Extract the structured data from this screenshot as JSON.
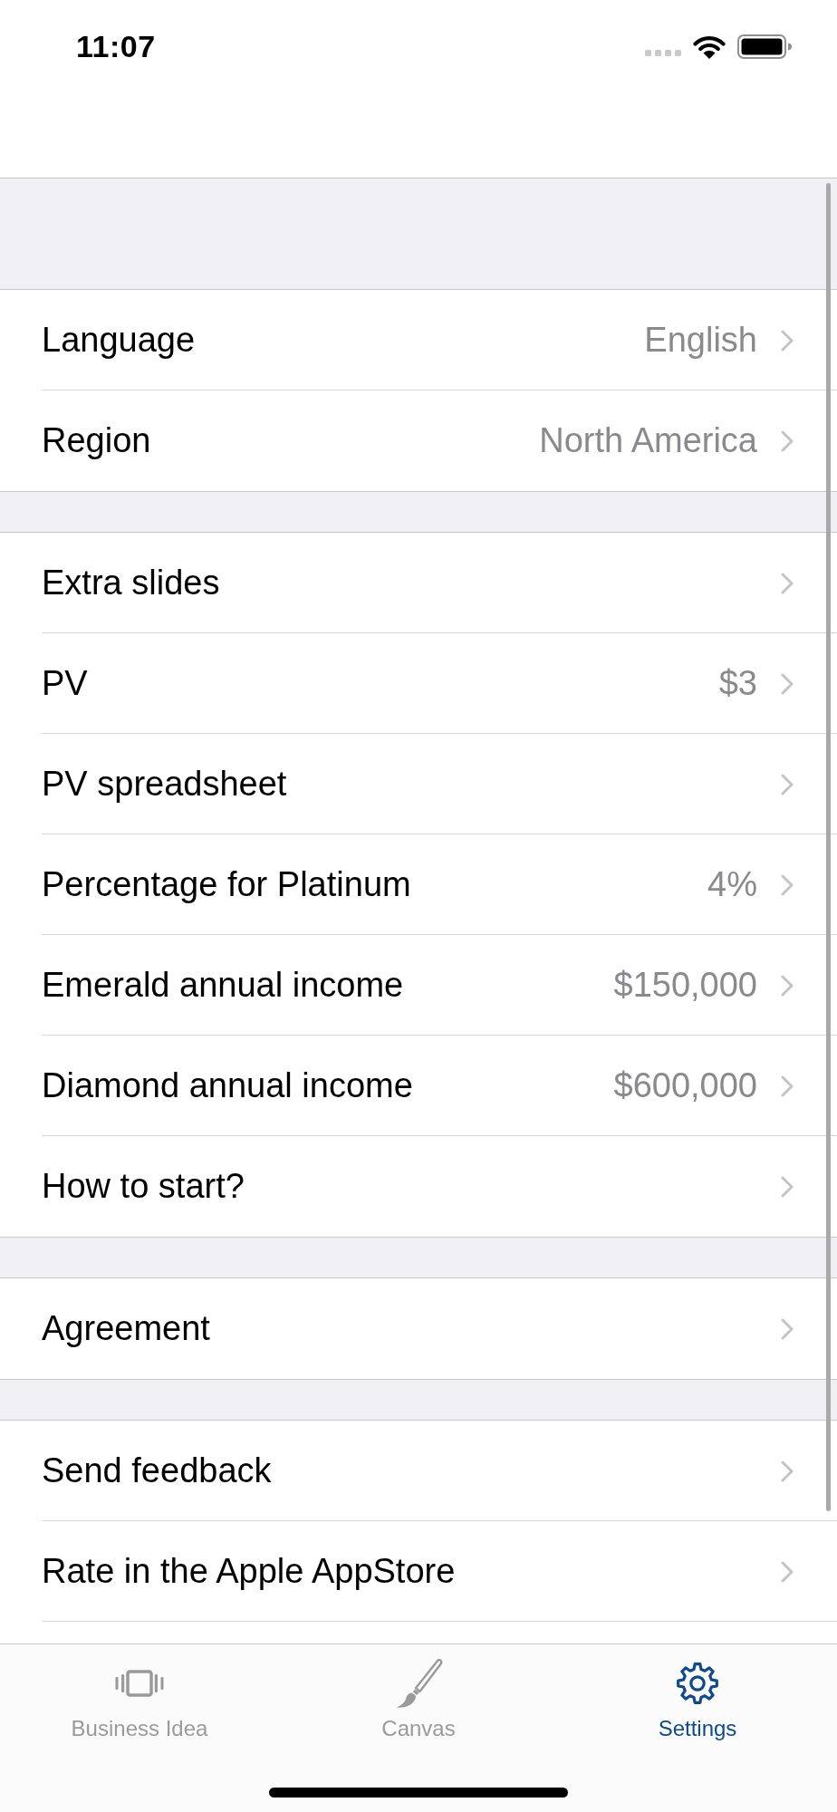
{
  "status_bar": {
    "time": "11:07"
  },
  "sections": [
    {
      "rows": [
        {
          "label": "Language",
          "value": "English"
        },
        {
          "label": "Region",
          "value": "North America"
        }
      ]
    },
    {
      "rows": [
        {
          "label": "Extra slides"
        },
        {
          "label": "PV",
          "value": "$3"
        },
        {
          "label": "PV spreadsheet"
        },
        {
          "label": "Percentage for Platinum",
          "value": "4%"
        },
        {
          "label": "Emerald annual income",
          "value": "$150,000"
        },
        {
          "label": "Diamond annual income",
          "value": "$600,000"
        },
        {
          "label": "How to start?"
        }
      ]
    },
    {
      "rows": [
        {
          "label": "Agreement"
        }
      ]
    },
    {
      "rows": [
        {
          "label": "Send feedback"
        },
        {
          "label": "Rate in the Apple AppStore"
        }
      ]
    }
  ],
  "tab_bar": {
    "tabs": [
      {
        "label": "Business Idea",
        "selected": false
      },
      {
        "label": "Canvas",
        "selected": false
      },
      {
        "label": "Settings",
        "selected": true
      }
    ]
  }
}
